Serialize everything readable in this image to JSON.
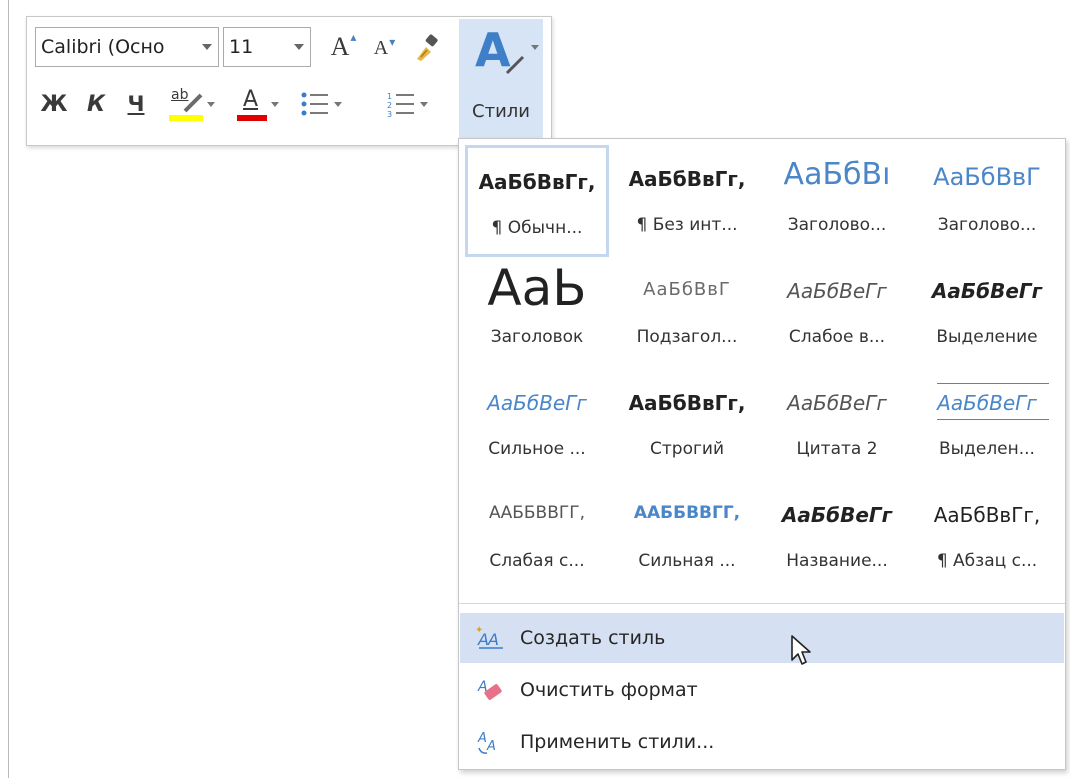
{
  "toolbar": {
    "font_name": "Calibri (Осно",
    "font_size": "11",
    "grow_font_label": "A",
    "shrink_font_label": "A",
    "bold_label": "Ж",
    "italic_label": "К",
    "underline_label": "Ч",
    "highlight_label": "ab",
    "font_color_label": "A",
    "styles_glyph": "A",
    "styles_label": "Стили",
    "highlight_color": "#ffff00",
    "font_color": "#e00000"
  },
  "styles_gallery": {
    "rows": [
      [
        {
          "sample": "АаБбВвГг,",
          "name": "¶ Обычн...",
          "selected": true
        },
        {
          "sample": "АаБбВвГг,",
          "name": "¶ Без инт..."
        },
        {
          "sample": "АаБбВı",
          "name": "Заголово..."
        },
        {
          "sample": "АаБбВвГ",
          "name": "Заголово..."
        }
      ],
      [
        {
          "sample": "АаЬ",
          "name": "Заголовок"
        },
        {
          "sample": "АаБбВвГ",
          "name": "Подзагол..."
        },
        {
          "sample": "АаБбВеГг",
          "name": "Слабое в..."
        },
        {
          "sample": "АаБбВеГг",
          "name": "Выделение"
        }
      ],
      [
        {
          "sample": "АаБбВеГг",
          "name": "Сильное ..."
        },
        {
          "sample": "АаБбВвГг,",
          "name": "Строгий"
        },
        {
          "sample": "АаБбВеГг",
          "name": "Цитата 2"
        },
        {
          "sample": "АаБбВеГг",
          "name": "Выделен..."
        }
      ],
      [
        {
          "sample": "ААББВВГГ,",
          "name": "Слабая с..."
        },
        {
          "sample": "ААББВВГГ,",
          "name": "Сильная ..."
        },
        {
          "sample": "АаБбВеГг",
          "name": "Название..."
        },
        {
          "sample": "АаБбВвГг,",
          "name": "¶ Абзац с..."
        }
      ]
    ]
  },
  "menu": {
    "create_style": "Создать стиль",
    "clear_format": "Очистить формат",
    "apply_styles": "Применить стили..."
  },
  "colors": {
    "accent_blue": "#4a86c8",
    "hover_bg": "#d5e1f2",
    "selected_border": "#c5d7ee"
  }
}
